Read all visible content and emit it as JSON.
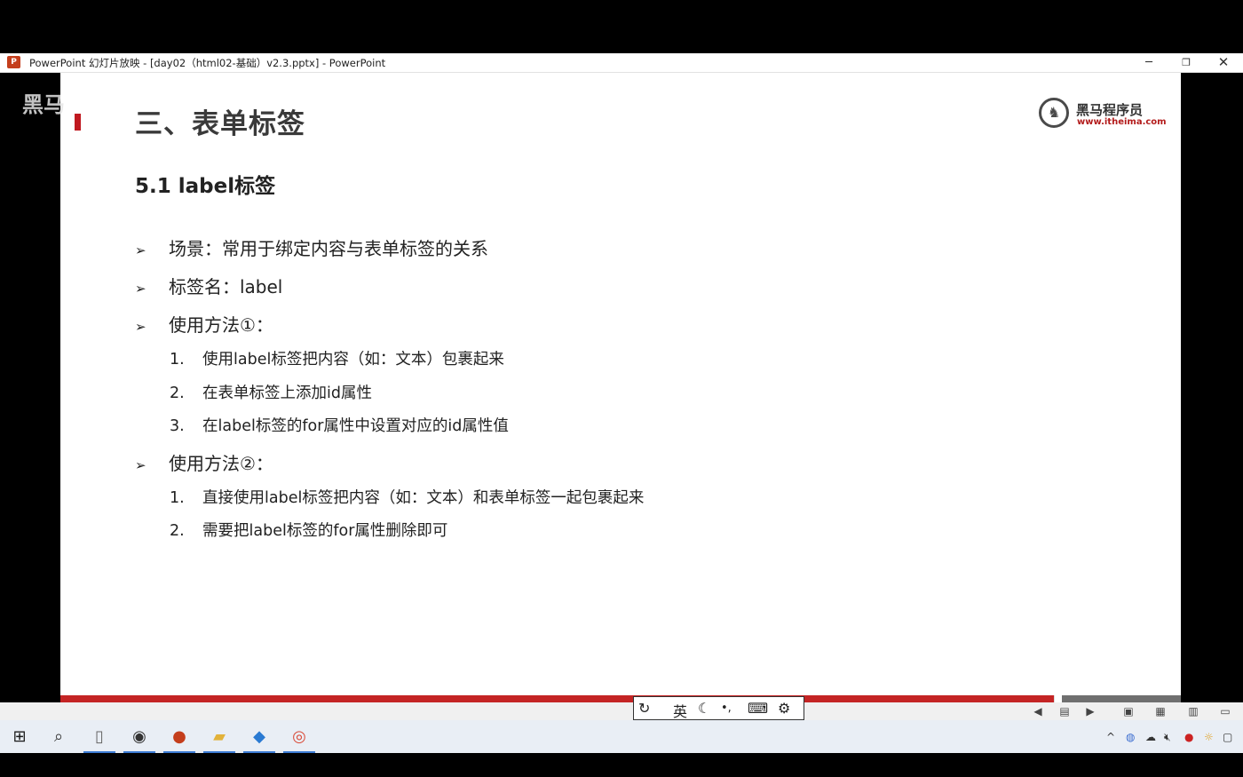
{
  "window": {
    "app_icon_letter": "P",
    "title": "PowerPoint 幻灯片放映 - [day02（html02-基础）v2.3.pptx] - PowerPoint",
    "minimize": "─",
    "maximize": "❐",
    "close": "✕"
  },
  "watermark": {
    "text": "黑马"
  },
  "slide": {
    "title": "三、表单标签",
    "brand": {
      "name": "黑马程序员",
      "url": "www.itheima.com"
    },
    "section_heading": "5.1 label标签",
    "bullet_marker": "➢",
    "bullets": [
      {
        "text": "场景：常用于绑定内容与表单标签的关系"
      },
      {
        "text": "标签名：label"
      },
      {
        "text": "使用方法①：",
        "subs": [
          {
            "num": "1.",
            "text": "使用label标签把内容（如：文本）包裹起来"
          },
          {
            "num": "2.",
            "text": "在表单标签上添加id属性"
          },
          {
            "num": "3.",
            "text": "在label标签的for属性中设置对应的id属性值"
          }
        ]
      },
      {
        "text": "使用方法②：",
        "subs": [
          {
            "num": "1.",
            "text": "直接使用label标签把内容（如：文本）和表单标签一起包裹起来"
          },
          {
            "num": "2.",
            "text": "需要把label标签的for属性删除即可"
          }
        ]
      }
    ]
  },
  "slideshow_progress": 0.887,
  "ime": {
    "mode": "英",
    "moon": "☾",
    "punct": "•,",
    "keyboard": "⌨",
    "settings": "⚙"
  },
  "colors": {
    "accent_red": "#c42424",
    "brand_red": "#b31b1b"
  }
}
